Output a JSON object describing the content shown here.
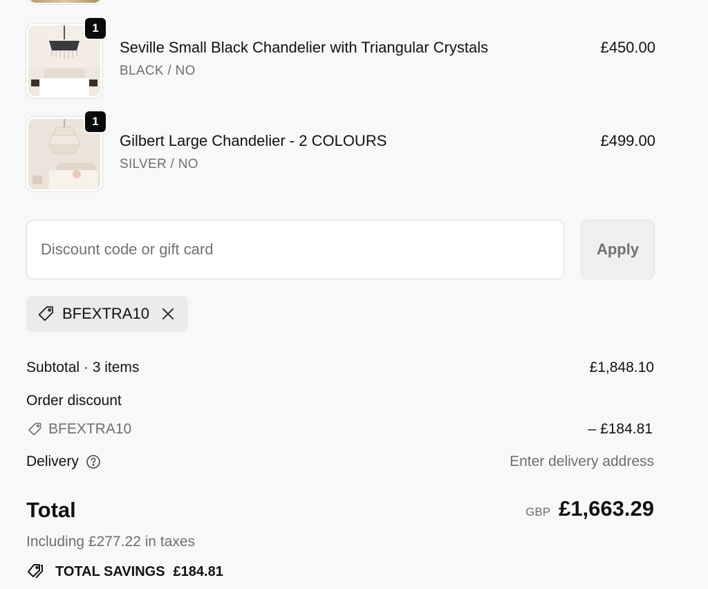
{
  "items": [
    {
      "quantity": "1",
      "name": "Seville Small Black Chandelier with Triangular Crystals",
      "variant": "BLACK / NO",
      "price": "£450.00"
    },
    {
      "quantity": "1",
      "name": "Gilbert Large Chandelier - 2 COLOURS",
      "variant": "SILVER / NO",
      "price": "£499.00"
    }
  ],
  "discount": {
    "placeholder": "Discount code or gift card",
    "apply_label": "Apply",
    "applied_code": "BFEXTRA10"
  },
  "summary": {
    "subtotal_label": "Subtotal · 3 items",
    "subtotal_value": "£1,848.10",
    "order_discount_label": "Order discount",
    "discount_code": "BFEXTRA10",
    "discount_value": "– £184.81",
    "delivery_label": "Delivery",
    "delivery_value": "Enter delivery address",
    "total_label": "Total",
    "currency": "GBP",
    "total_value": "£1,663.29",
    "tax_note": "Including £277.22 in taxes",
    "savings_label": "TOTAL SAVINGS",
    "savings_value": "£184.81"
  }
}
